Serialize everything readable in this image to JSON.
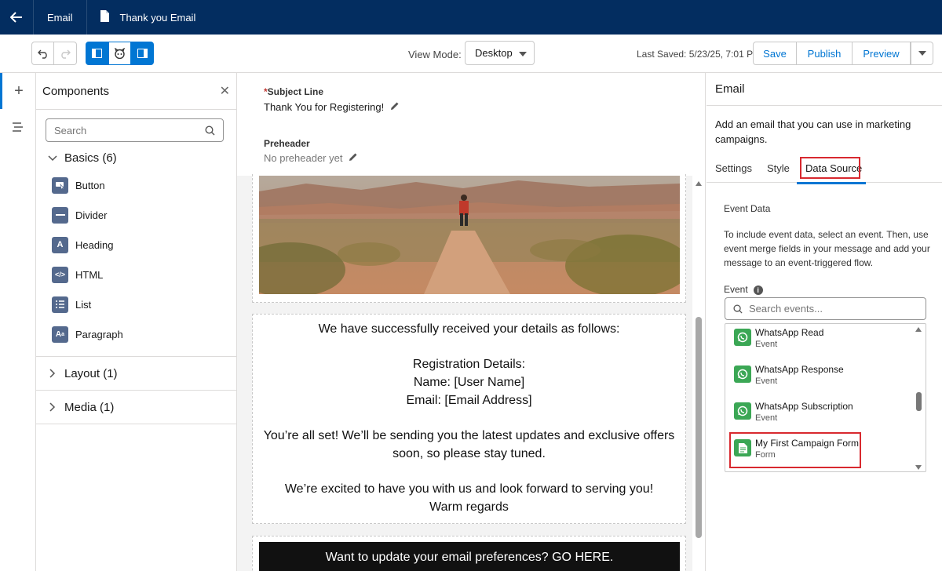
{
  "topbar": {
    "back_icon": "arrow-left-icon",
    "crumb1": "Email",
    "crumb2": "Thank you Email",
    "bg_color": "#032d60"
  },
  "toolbar": {
    "view_mode_label": "View Mode:",
    "view_mode_value": "Desktop",
    "last_saved": "Last Saved: 5/23/25, 7:01 PM",
    "save_label": "Save",
    "publish_label": "Publish",
    "preview_label": "Preview",
    "accent_color": "#0176d3"
  },
  "components": {
    "title": "Components",
    "search_placeholder": "Search",
    "sections": [
      {
        "label": "Basics (6)",
        "expanded": true
      },
      {
        "label": "Layout (1)",
        "expanded": false
      },
      {
        "label": "Media (1)",
        "expanded": false
      }
    ],
    "basics": [
      {
        "label": "Button",
        "icon": "button-icon"
      },
      {
        "label": "Divider",
        "icon": "divider-icon"
      },
      {
        "label": "Heading",
        "icon": "heading-icon"
      },
      {
        "label": "HTML",
        "icon": "code-icon"
      },
      {
        "label": "List",
        "icon": "list-icon"
      },
      {
        "label": "Paragraph",
        "icon": "paragraph-icon"
      }
    ]
  },
  "canvas": {
    "subject_label": "Subject Line",
    "subject_required": "*",
    "subject_value": "Thank You for Registering!",
    "preheader_label": "Preheader",
    "preheader_value": "No preheader yet",
    "body_lines": {
      "l1": "We have successfully received your details as follows:",
      "l2": "Registration Details:",
      "l3": "Name: [User Name]",
      "l4": "Email: [Email Address]",
      "l5": "You’re all set! We’ll be sending you the latest updates and exclusive offers",
      "l6": "soon, so please stay tuned.",
      "l7": "We’re excited to have you with us and look forward to serving you!",
      "l8": "Warm regards"
    },
    "footer_text": "Want to update your email preferences? GO HERE."
  },
  "right_panel": {
    "title": "Email",
    "description": "Add an email that you can use in marketing campaigns.",
    "tabs": [
      "Settings",
      "Style",
      "Data Source"
    ],
    "active_tab": "Data Source",
    "event_data_label": "Event Data",
    "help_text": "To include event data, select an event. Then, use event merge fields in your message and add your message to an event-triggered flow.",
    "event_label": "Event",
    "event_search_placeholder": "Search events...",
    "events": [
      {
        "name": "WhatsApp Read",
        "type": "Event",
        "icon": "whatsapp-icon"
      },
      {
        "name": "WhatsApp Response",
        "type": "Event",
        "icon": "whatsapp-icon"
      },
      {
        "name": "WhatsApp Subscription",
        "type": "Event",
        "icon": "whatsapp-icon"
      },
      {
        "name": "My First Campaign Form",
        "type": "Form",
        "icon": "form-icon"
      }
    ],
    "highlight_color": "#d8292f",
    "event_icon_color": "#3ba755"
  }
}
